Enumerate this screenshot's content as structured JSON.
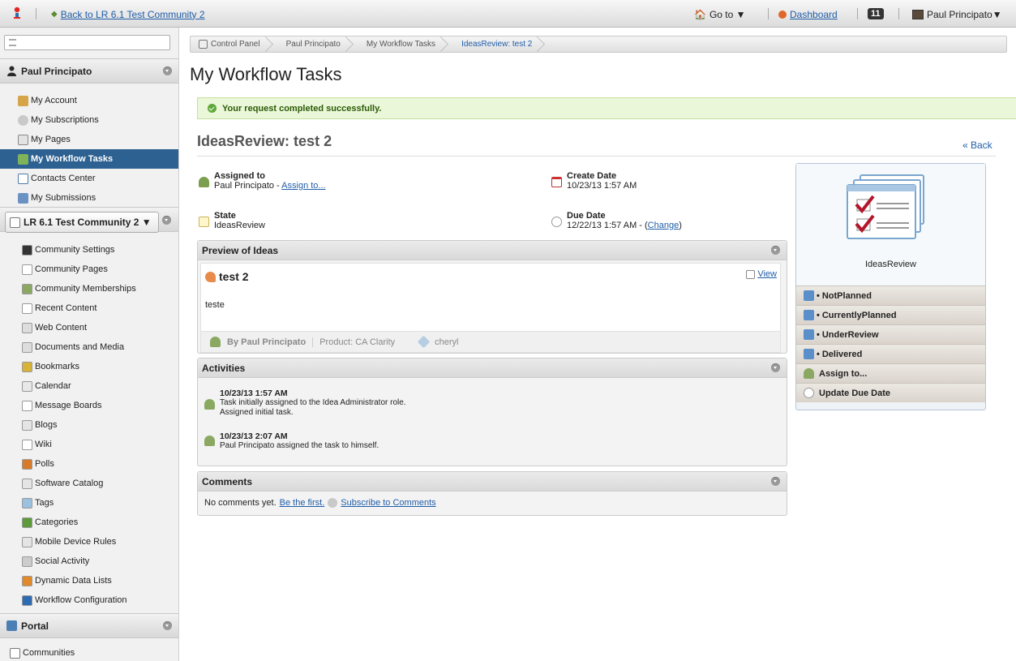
{
  "topbar": {
    "back_label": "Back to LR 6.1 Test Community 2",
    "goto_label": "Go to ▼",
    "dashboard_label": "Dashboard",
    "notification_count": "11",
    "user_label": "Paul Principato▼"
  },
  "sidebar": {
    "search_placeholder": "",
    "user_panel": {
      "title": "Paul Principato",
      "items": [
        {
          "label": "My Account"
        },
        {
          "label": "My Subscriptions"
        },
        {
          "label": "My Pages"
        },
        {
          "label": "My Workflow Tasks"
        },
        {
          "label": "Contacts Center"
        },
        {
          "label": "My Submissions"
        }
      ]
    },
    "community_selector": "LR 6.1 Test Community 2 ▼",
    "community_items": [
      {
        "label": "Community Settings"
      },
      {
        "label": "Community Pages"
      },
      {
        "label": "Community Memberships"
      },
      {
        "label": "Recent Content"
      },
      {
        "label": "Web Content"
      },
      {
        "label": "Documents and Media"
      },
      {
        "label": "Bookmarks"
      },
      {
        "label": "Calendar"
      },
      {
        "label": "Message Boards"
      },
      {
        "label": "Blogs"
      },
      {
        "label": "Wiki"
      },
      {
        "label": "Polls"
      },
      {
        "label": "Software Catalog"
      },
      {
        "label": "Tags"
      },
      {
        "label": "Categories"
      },
      {
        "label": "Mobile Device Rules"
      },
      {
        "label": "Social Activity"
      },
      {
        "label": "Dynamic Data Lists"
      },
      {
        "label": "Workflow Configuration"
      }
    ],
    "portal_panel": {
      "title": "Portal",
      "items": [
        {
          "label": "Communities"
        }
      ]
    }
  },
  "breadcrumb": [
    {
      "label": "Control Panel"
    },
    {
      "label": "Paul Principato"
    },
    {
      "label": "My Workflow Tasks"
    },
    {
      "label": "IdeasReview: test 2"
    }
  ],
  "page_title": "My Workflow Tasks",
  "success_message": "Your request completed successfully.",
  "task": {
    "title": "IdeasReview: test 2",
    "back_label": "« Back",
    "assigned_to_label": "Assigned to",
    "assigned_to_value": "Paul Principato",
    "assign_link_prefix": " - ",
    "assign_link": "Assign to...",
    "create_date_label": "Create Date",
    "create_date_value": "10/23/13 1:57 AM",
    "state_label": "State",
    "state_value": "IdeasReview",
    "due_date_label": "Due Date",
    "due_date_value": "12/22/13 1:57 AM - (",
    "due_date_change": "Change",
    "due_date_suffix": ")"
  },
  "preview": {
    "header": "Preview of Ideas",
    "item_title": "test 2",
    "view_label": "View",
    "body": "teste",
    "author": "By Paul Principato",
    "product": "Product: CA Clarity",
    "tag": "cheryl"
  },
  "activities": {
    "header": "Activities",
    "entries": [
      {
        "date": "10/23/13 1:57 AM",
        "line1": "Task initially assigned to the Idea Administrator role.",
        "line2": "Assigned initial task."
      },
      {
        "date": "10/23/13 2:07 AM",
        "line1": "Paul Principato assigned the task to himself.",
        "line2": ""
      }
    ]
  },
  "comments": {
    "header": "Comments",
    "empty_text": "No comments yet.",
    "be_first": "Be the first.",
    "subscribe": "Subscribe to Comments"
  },
  "workflow_box": {
    "name": "IdeasReview",
    "actions": [
      {
        "label": "NotPlanned"
      },
      {
        "label": "CurrentlyPlanned"
      },
      {
        "label": "UnderReview"
      },
      {
        "label": "Delivered"
      },
      {
        "label": "Assign to..."
      },
      {
        "label": "Update Due Date"
      }
    ]
  },
  "colors": {
    "active_nav": "#2d6191",
    "link": "#1f5da8",
    "success_bg": "#eaf7d9"
  }
}
